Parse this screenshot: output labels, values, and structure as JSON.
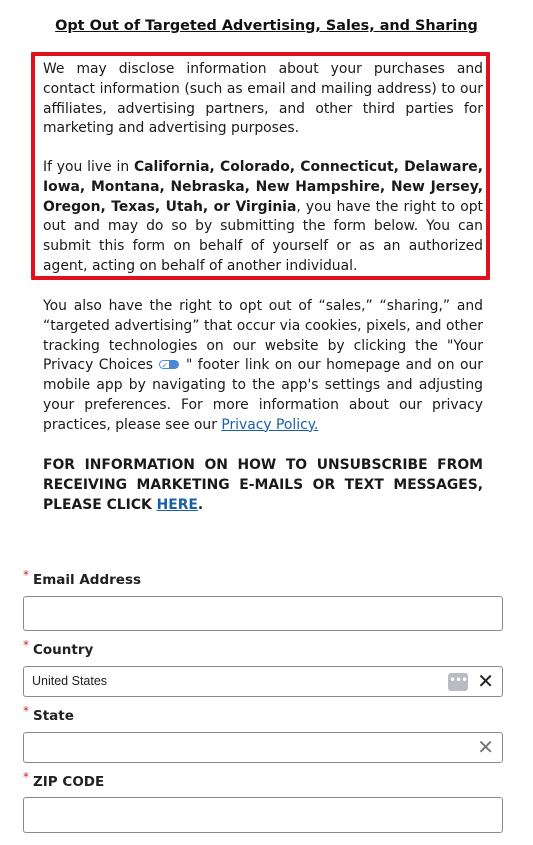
{
  "heading": "Opt Out of Targeted Advertising, Sales, and Sharing",
  "notice": {
    "p1": "We may disclose information about your purchases and contact information (such as email and mailing address) to our affiliates, advertising partners, and other third parties for marketing and advertising purposes.",
    "p2_prefix": "If you live in ",
    "p2_states": "California, Colorado, Connecticut, Delaware, Iowa, Montana, Nebraska, New Hampshire, New Jersey, Oregon, Texas, Utah, or Virginia",
    "p2_suffix": ", you have the right to opt out and may do so by submitting the form below. You can submit this form on behalf of yourself or as an authorized agent, acting on behalf of another individual."
  },
  "cookies_text": {
    "part1": "You also have the right to opt out of “sales,” “sharing,” and “targeted advertising” that occur via cookies, pixels, and other tracking technologies on our website by clicking the \"Your Privacy Choices",
    "part2": " \" footer link on our homepage and on our mobile app by navigating to the app's settings and adjusting your preferences. For more information about our privacy practices, please see our ",
    "privacy_link": "Privacy Policy."
  },
  "unsubscribe": {
    "text": "FOR INFORMATION ON HOW TO UNSUBSCRIBE FROM RECEIVING MARKETING E-MAILS OR TEXT MESSAGES, PLEASE CLICK ",
    "link": "HERE",
    "end": "."
  },
  "form": {
    "required_marker": "*",
    "email_label": "Email Address",
    "email_value": "",
    "country_label": "Country",
    "country_value": "United States",
    "more_glyph": "•••",
    "clear_glyph": "✕",
    "state_label": "State",
    "state_value": "",
    "zip_label": "ZIP CODE",
    "zip_value": ""
  },
  "colors": {
    "highlight_border": "#e0111d",
    "link": "#1a5fa8",
    "required": "#d1242f",
    "privacy_icon": "#4b86d9"
  },
  "icons": {
    "privacy_choices": "privacy-choices-toggle-icon",
    "more": "more-options-icon",
    "clear": "close-icon"
  }
}
